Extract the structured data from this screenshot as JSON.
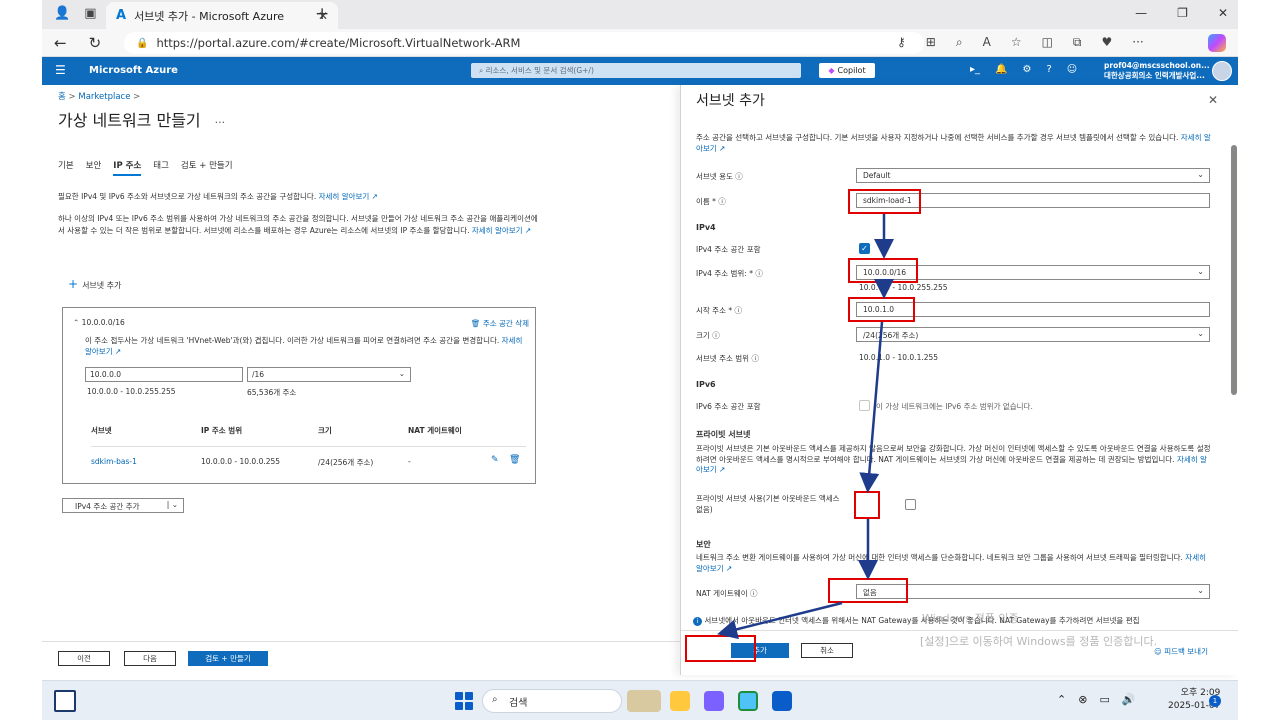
{
  "browser": {
    "tab_title": "서브넷 추가 - Microsoft Azure",
    "url": "https://portal.azure.com/#create/Microsoft.VirtualNetwork-ARM"
  },
  "azure": {
    "brand": "Microsoft Azure",
    "search_placeholder": "리소스, 서비스 및 문서 검색(G+/)",
    "copilot": "Copilot",
    "user_email": "prof04@mscsschool.on...",
    "user_org": "대한상공회의소 인력개발사업..."
  },
  "left": {
    "breadcrumb_home": "홈",
    "breadcrumb_marketplace": "Marketplace",
    "title": "가상 네트워크 만들기",
    "tabs": [
      "기본",
      "보안",
      "IP 주소",
      "태그",
      "검토 + 만들기"
    ],
    "desc1": "필요한 IPv4 및 IPv6 주소와 서브넷으로 가상 네트워크의 주소 공간을 구성합니다.",
    "desc1_link": "자세히 알아보기",
    "desc2": "하나 이상의 IPv4 또는 IPv6 주소 범위를 사용하여 가상 네트워크의 주소 공간을 정의합니다. 서브넷을 만들어 가상 네트워크 주소 공간을 애플리케이션에서 사용할 수 있는 더 작은 범위로 분할합니다. 서브넷에 리소스를 배포하는 경우 Azure는 리소스에 서브넷의 IP 주소를 할당합니다.",
    "desc2_link": "자세히 알아보기",
    "add_subnet": "서브넷 추가",
    "space_header": "10.0.0.0/16",
    "delete_space": "주소 공간 삭제",
    "warning": "이 주소 접두사는 가상 네트워크 'HVnet-Web'과(와) 겹칩니다. 이러한 가상 네트워크를 피어로 연결하려면 주소 공간을 변경합니다.",
    "warning_link": "자세히 알아보기",
    "addr_input": "10.0.0.0",
    "prefix_select": "/16",
    "addr_range": "10.0.0.0 - 10.0.255.255",
    "addr_count": "65,536개 주소",
    "table_headers": [
      "서브넷",
      "IP 주소 범위",
      "크기",
      "NAT 게이트웨이"
    ],
    "rows": [
      {
        "name": "sdkim-bas-1",
        "range": "10.0.0.0 - 10.0.0.255",
        "size": "/24(256개 주소)",
        "nat": "-"
      }
    ],
    "add_v4": "IPv4 주소 공간 추가",
    "btn_prev": "이전",
    "btn_next": "다음",
    "btn_review": "검토 + 만들기"
  },
  "panel": {
    "title": "서브넷 추가",
    "desc": "주소 공간을 선택하고 서브넷을 구성합니다. 기본 서브넷을 사용자 지정하거나 나중에 선택한 서비스를 추가할 경우 서브넷 템플릿에서 선택할 수 있습니다.",
    "desc_link": "자세히 알아보기",
    "purpose_label": "서브넷 용도",
    "purpose_value": "Default",
    "name_label": "이름 *",
    "name_value": "sdkim-load-1",
    "ipv4_section": "IPv4",
    "include_v4_label": "IPv4 주소 공간 포함",
    "v4_range_label": "IPv4 주소 범위: *",
    "v4_range_value": "10.0.0.0/16",
    "v4_range_sub": "10.0.0.0 - 10.0.255.255",
    "start_label": "시작 주소 *",
    "start_value": "10.0.1.0",
    "size_label": "크기",
    "size_value": "/24(256개 주소)",
    "subnet_range_label": "서브넷 주소 범위",
    "subnet_range_value": "10.0.1.0 - 10.0.1.255",
    "ipv6_section": "IPv6",
    "include_v6_label": "IPv6 주소 공간 포함",
    "include_v6_note": "이 가상 네트워크에는 IPv6 주소 범위가 없습니다.",
    "private_section": "프라이빗 서브넷",
    "private_desc": "프라이빗 서브넷은 기본 아웃바운드 액세스를 제공하지 않음으로써 보안을 강화합니다. 가상 머신이 인터넷에 액세스할 수 있도록 아웃바운드 연결을 사용하도록 설정하려면 아웃바운드 액세스를 명시적으로 부여해야 합니다. NAT 게이트웨이는 서브넷의 가상 머신에 아웃바운드 연결을 제공하는 데 권장되는 방법입니다.",
    "private_link": "자세히 알아보기",
    "private_check_label": "프라이빗 서브넷 사용(기본 아웃바운드 액세스 없음)",
    "security_section": "보안",
    "security_desc": "네트워크 주소 변환 게이트웨이를 사용하여 가상 머신에 대한 인터넷 액세스를 단순화합니다. 네트워크 보안 그룹을 사용하여 서브넷 트래픽을 필터링합니다.",
    "security_link": "자세히 알아보기",
    "nat_label": "NAT 게이트웨이",
    "nat_value": "없음",
    "info_text": "서브넷에서 아웃바운드 인터넷 액세스를 위해서는 NAT Gateway를 사용하는 것이 좋습니다. NAT Gateway를 추가하려면 서브넷을 편집",
    "btn_add": "추가",
    "btn_cancel": "취소",
    "feedback": "피드백 보내기"
  },
  "watermark": {
    "line1": "Windows 정품 인증",
    "line2": "[설정]으로 이동하여 Windows를 정품 인증합니다."
  },
  "taskbar": {
    "search": "검색",
    "time": "오후 2:09",
    "date": "2025-01-07",
    "notif_count": "1"
  },
  "colors": {
    "azure_blue": "#0f6cbd",
    "highlight_red": "#e00000",
    "arrow_navy": "#1f3b8c"
  }
}
